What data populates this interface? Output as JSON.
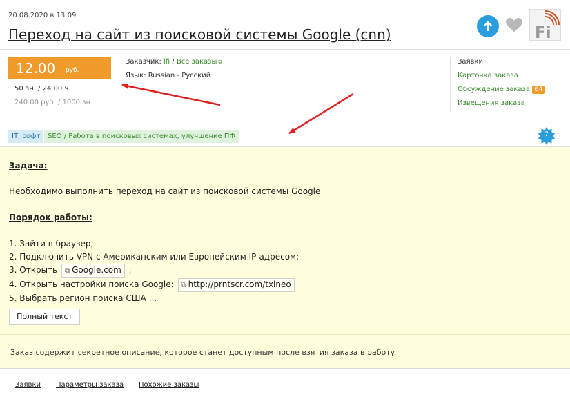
{
  "header": {
    "date": "20.08.2020 в 13:09",
    "title": "Переход на сайт из поисковой системы Google (cnn)",
    "logo_text": "Fi"
  },
  "price": {
    "value": "12.00",
    "currency": "руб.",
    "rate_line1": "50 зн.  / 24.00 ч.",
    "rate_line2": "240.00 руб.  / 1000 зн."
  },
  "meta": {
    "customer_label": "Заказчик:",
    "customer_name": "lfi",
    "separator": "/",
    "all_orders": "Все заказы",
    "language_label": "Язык:",
    "language_value": "Russian - Русский"
  },
  "right_menu": {
    "heading": "Заявки",
    "card": "Карточка заказа",
    "discussion": "Обсуждение заказа",
    "discussion_count": "64",
    "notices": "Извещения заказа"
  },
  "tags": {
    "category": "IT, софт",
    "subcategory": "SEO / Работа в поисковых системах, улучшение ПФ"
  },
  "star_badge": "7",
  "description": {
    "task_heading": "Задача:",
    "task_text": "Необходимо выполнить переход на сайт из поисковой системы Google",
    "order_heading": "Порядок работы:",
    "step1": "1. Зайти в браузер;",
    "step2": "2. Подключить VPN с Американским или Европейским IP-адресом;",
    "step3_prefix": "3. Открыть",
    "step3_chip": "Google.com",
    "step3_suffix": ";",
    "step4_prefix": "4. Открыть настройки поиска Google:",
    "step4_chip": "http://prntscr.com/txlneo",
    "step5": "5. Выбрать регион поиска США",
    "more": "...",
    "full_text_button": "Полный текст"
  },
  "secret_note": "Заказ содержит секретное описание, которое станет доступным после взятия заказа в работу",
  "bottom_tabs": [
    "Заявки",
    "Параметры заказа",
    "Похожие заказы"
  ],
  "colors": {
    "accent_orange": "#f09a2a",
    "link_green": "#3c8a2e",
    "up_button_blue": "#2a9ddf",
    "desc_background": "#ffffdd",
    "arrow_red": "#e02020"
  }
}
